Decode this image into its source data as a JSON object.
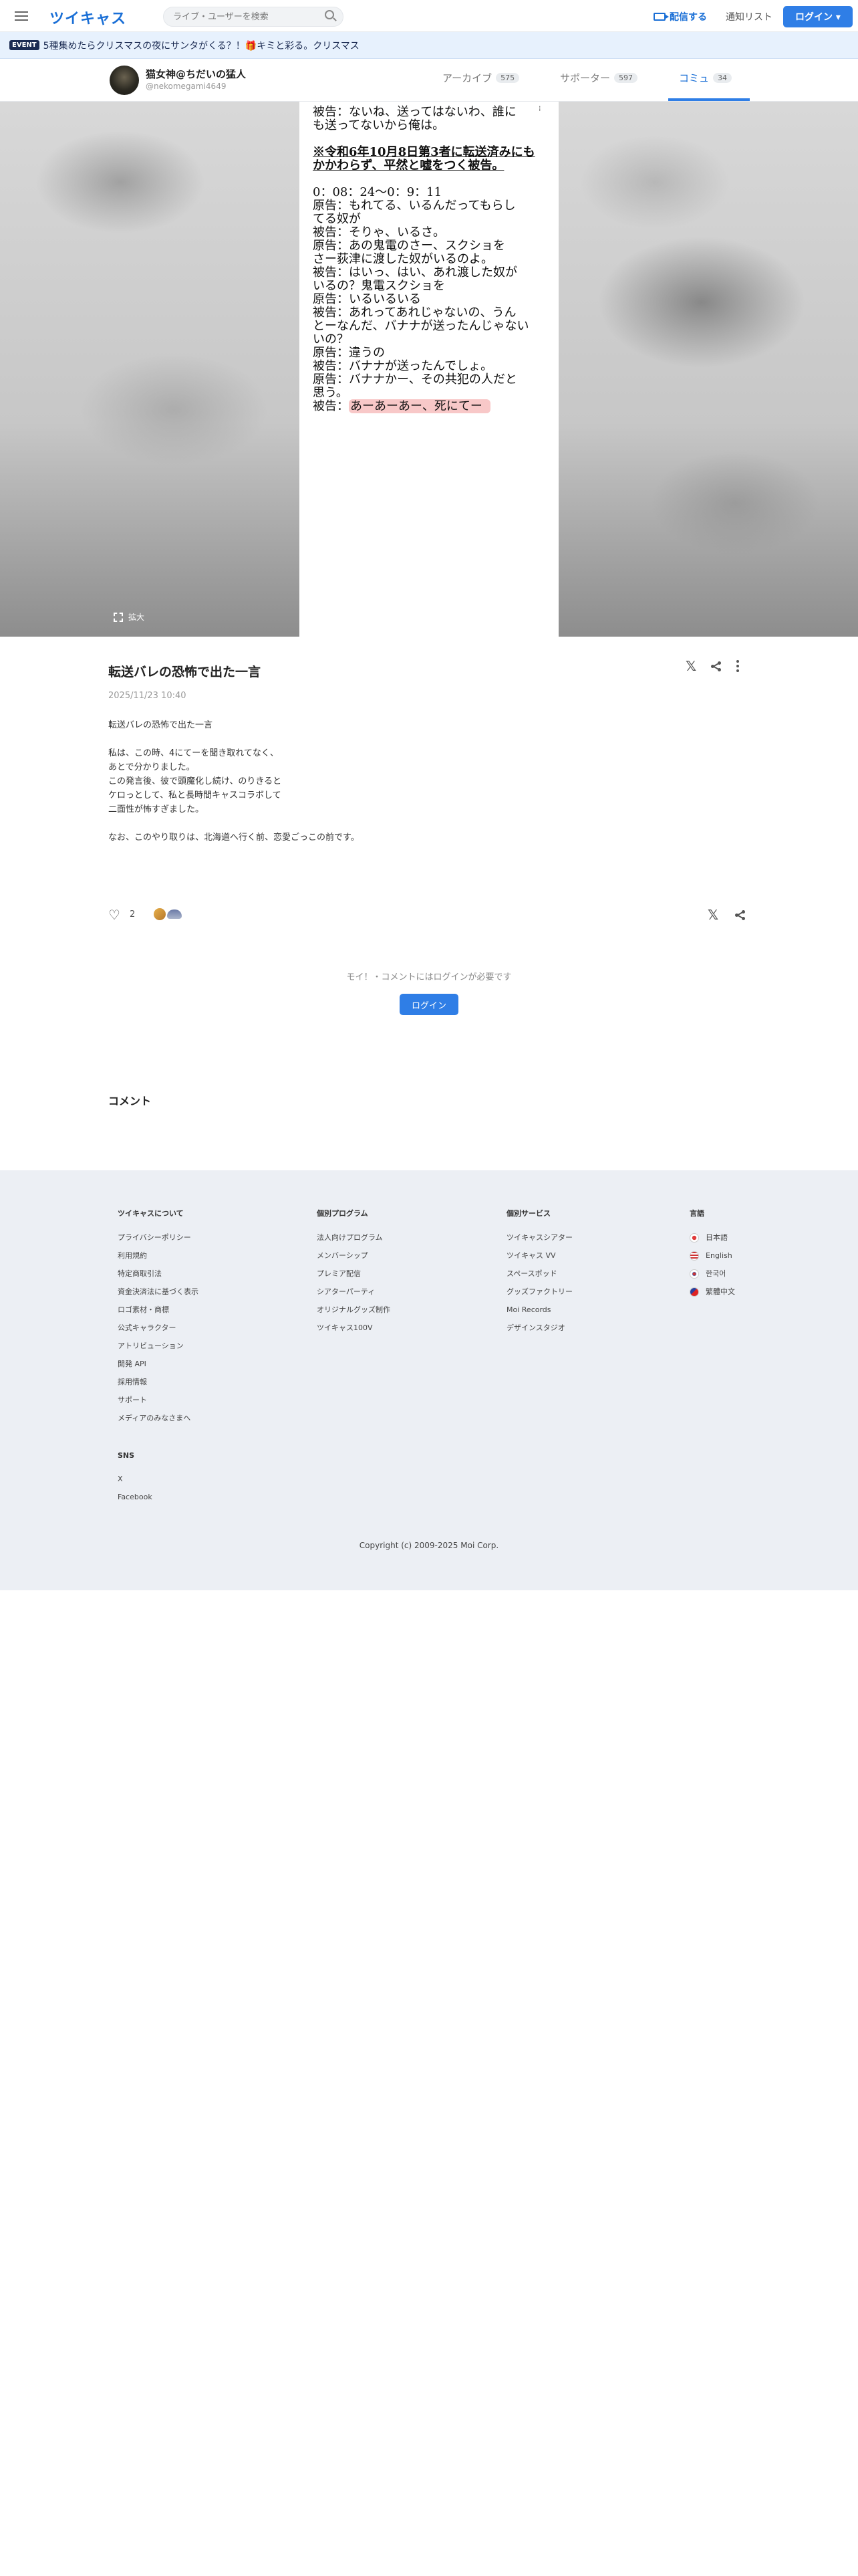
{
  "header": {
    "logo": "ツイキャス",
    "search_placeholder": "ライブ・ユーザーを検索",
    "broadcast_label": "配信する",
    "notify_label": "通知リスト",
    "login_label": "ログイン ▾"
  },
  "event": {
    "badge": "EVENT",
    "text": "5種集めたらクリスマスの夜にサンタがくる？！🎁キミと彩る。クリスマス"
  },
  "profile": {
    "name": "猫女神@ちだいの猛人",
    "id": "@nekomegami4649",
    "tabs": [
      {
        "label": "アーカイブ",
        "count": "575"
      },
      {
        "label": "サポーター",
        "count": "597"
      },
      {
        "label": "コミュ",
        "count": "34"
      }
    ]
  },
  "hero": {
    "flag": "⁞",
    "lines_top": [
      "被告：ないね、送ってはないわ、誰に",
      "も送ってないから俺は。"
    ],
    "bold_lines": [
      "※令和6年10月8日第3者に転送済みにも",
      "かかわらず、平然と嘘をつく被告。"
    ],
    "transcript": [
      "0：08：24〜0：9：11",
      "原告：もれてる、いるんだってもらし",
      "てる奴が",
      "被告：そりゃ、いるさ。",
      "原告：あの鬼電のさー、スクショを",
      "さー荻津に渡した奴がいるのよ。",
      "被告：はいっ、はい、あれ渡した奴が",
      "いるの？鬼電スクショを",
      "原告：いるいるいる",
      "被告：あれってあれじゃないの、うん",
      "とーなんだ、バナナが送ったんじゃない",
      "いの？",
      "原告：違うの",
      "被告：バナナが送ったんでしょ。",
      "原告：バナナかー、その共犯の人だと",
      "思う。"
    ],
    "last_prefix": "被告：",
    "last_highlight": "あーあーあー、死にてー",
    "expand_label": "拡大"
  },
  "post": {
    "title": "転送バレの恐怖で出た一言",
    "date": "2025/11/23 10:40",
    "paragraphs": [
      [
        "転送バレの恐怖で出た一言"
      ],
      [
        "私は、この時、4にてーを聞き取れてなく、",
        "あとで分かりました。",
        "この発言後、彼で頭魔化し続け、のりきると",
        "ケロっとして、私と長時間キャスコラボして",
        "二面性が怖すぎました。"
      ],
      [
        "なお、このやり取りは、北海道へ行く前、恋愛ごっこの前です。"
      ]
    ],
    "like_count": "2"
  },
  "comments": {
    "login_note": "モイ！・コメントにはログインが必要です",
    "login_button": "ログイン",
    "heading": "コメント"
  },
  "footer": {
    "columns": [
      {
        "title": "ツイキャスについて",
        "links": [
          "プライバシーポリシー",
          "利用規約",
          "特定商取引法",
          "資金決済法に基づく表示",
          "ロゴ素材・商標",
          "公式キャラクター",
          "アトリビューション",
          "開発 API",
          "採用情報",
          "サポート",
          "メディアのみなさまへ"
        ]
      },
      {
        "title": "個別プログラム",
        "links": [
          "法人向けプログラム",
          "メンバーシップ",
          "プレミア配信",
          "シアターパーティ",
          "オリジナルグッズ制作",
          "ツイキャス100V"
        ]
      },
      {
        "title": "個別サービス",
        "links": [
          "ツイキャスシアター",
          "ツイキャス VV",
          "スペースポッド",
          "グッズファクトリー",
          "Moi Records",
          "デザインスタジオ"
        ]
      }
    ],
    "sns_title": "SNS",
    "sns_links": [
      "X",
      "Facebook"
    ],
    "lang_title": "言語",
    "languages": [
      "日本語",
      "English",
      "한국어",
      "繁體中文"
    ],
    "copyright": "Copyright (c) 2009-2025 Moi Corp."
  }
}
